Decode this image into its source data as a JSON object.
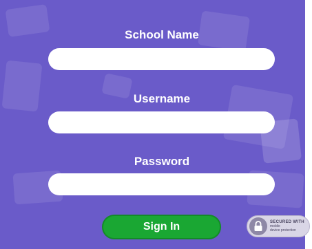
{
  "form": {
    "school_label": "School Name",
    "school_value": "",
    "username_label": "Username",
    "username_value": "",
    "password_label": "Password",
    "password_value": "",
    "signin_label": "Sign In"
  },
  "badge": {
    "icon": "lock-icon",
    "line1": "SECURED WITH",
    "line2": "mobile",
    "line3": "device protection"
  },
  "colors": {
    "panel": "#6a5bc9",
    "button": "#1aa733",
    "field": "#ffffff"
  }
}
